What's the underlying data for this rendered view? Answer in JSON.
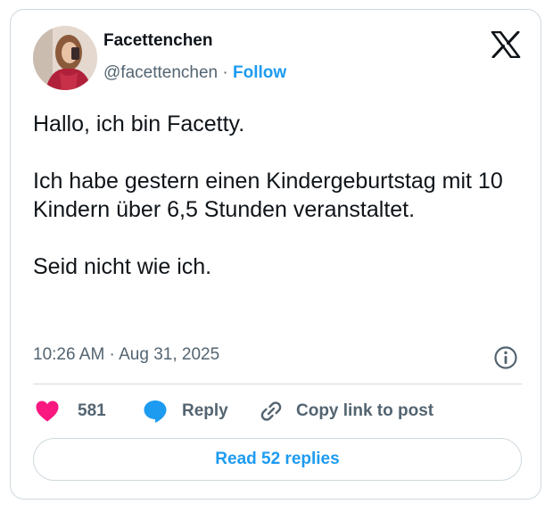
{
  "author": {
    "name": "Facettenchen",
    "handle": "@facettenchen",
    "separator": "·",
    "follow_label": "Follow"
  },
  "tweet": {
    "text": "Hallo, ich bin Facetty.\n\nIch habe gestern einen Kindergeburtstag mit 10 Kindern über 6,5 Stunden veranstaltet.\n\nSeid nicht wie ich.",
    "timestamp": "10:26 AM · Aug 31, 2025"
  },
  "actions": {
    "likes_count": "581",
    "reply_label": "Reply",
    "copy_link_label": "Copy link to post"
  },
  "read_replies_label": "Read 52 replies",
  "icons": {
    "avatar": "avatar-photo",
    "logo": "x-logo-icon",
    "info": "info-icon",
    "like": "heart-icon",
    "reply": "speech-bubble-icon",
    "copy": "link-icon"
  },
  "colors": {
    "accent": "#1d9bf0",
    "like": "#f91880",
    "text": "#0f1419",
    "secondary_text": "#536471",
    "border": "#cfd9de"
  }
}
